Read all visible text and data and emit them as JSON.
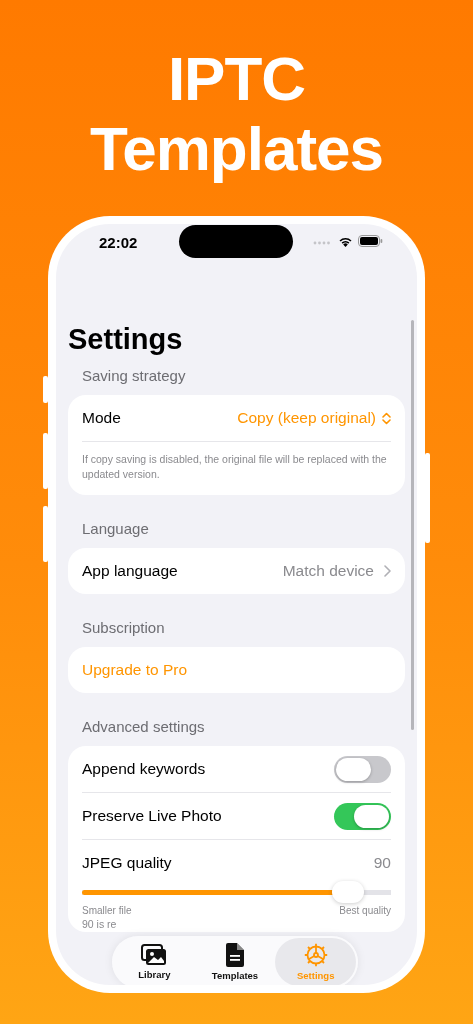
{
  "headline": [
    "IPTC",
    "Templates"
  ],
  "status_bar": {
    "time": "22:02"
  },
  "page_title": "Settings",
  "sections": [
    {
      "header": "Saving strategy",
      "rows": [
        {
          "kind": "picker",
          "label": "Mode",
          "value": "Copy (keep original)"
        },
        {
          "kind": "note",
          "text": "If copy saving is disabled, the original file will be replaced with the updated version."
        }
      ]
    },
    {
      "header": "Language",
      "rows": [
        {
          "kind": "link",
          "label": "App language",
          "value": "Match device"
        }
      ]
    },
    {
      "header": "Subscription",
      "rows": [
        {
          "kind": "action",
          "label": "Upgrade to Pro"
        }
      ]
    },
    {
      "header": "Advanced settings",
      "rows": [
        {
          "kind": "toggle",
          "label": "Append keywords",
          "on": false
        },
        {
          "kind": "toggle",
          "label": "Preserve Live Photo",
          "on": true
        },
        {
          "kind": "slider",
          "label": "JPEG quality",
          "reading": "90",
          "level": 0.86,
          "min_label": "Smaller file",
          "max_label": "Best quality",
          "note": "90 is re"
        }
      ]
    }
  ],
  "tab_bar": [
    {
      "label": "Library",
      "kind": "library",
      "selected": false
    },
    {
      "label": "Templates",
      "kind": "templates",
      "selected": false
    },
    {
      "label": "Settings",
      "kind": "settings",
      "selected": true
    }
  ]
}
